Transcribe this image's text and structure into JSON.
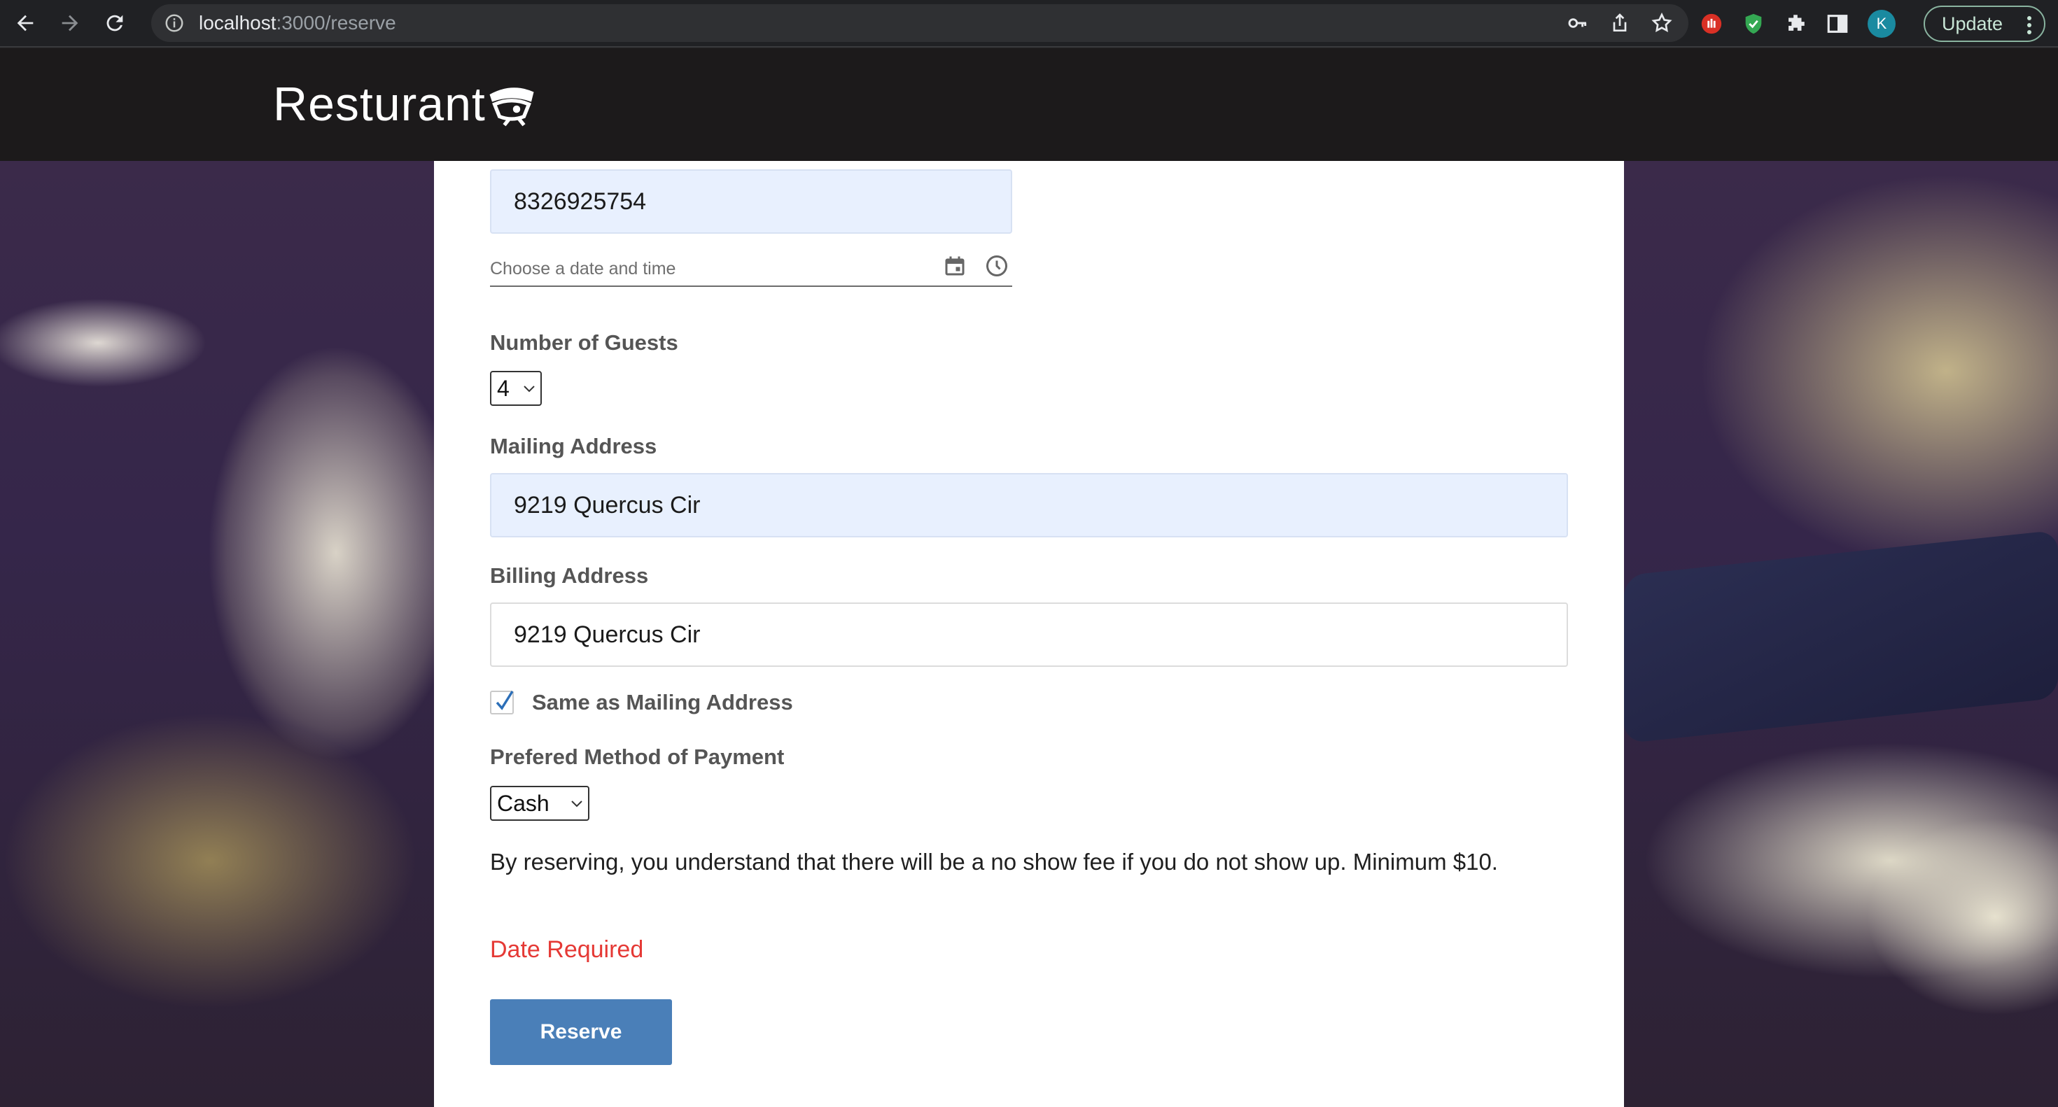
{
  "browser": {
    "url_host": "localhost",
    "url_path": ":3000/reserve",
    "avatar_letter": "K",
    "update_label": "Update",
    "icons": [
      "back-arrow-icon",
      "forward-arrow-icon",
      "reload-icon",
      "info-icon",
      "key-icon",
      "share-icon",
      "star-icon",
      "extension-icon",
      "sidepanel-icon"
    ]
  },
  "site": {
    "brand": "Resturant"
  },
  "form": {
    "phone_value": "8326925754",
    "date_placeholder": "Choose a date and time",
    "guests_label": "Number of Guests",
    "guests_value": "4",
    "mailing_label": "Mailing Address",
    "mailing_value": "9219 Quercus Cir",
    "billing_label": "Billing Address",
    "billing_value": "9219 Quercus Cir",
    "same_as_label": "Same as Mailing Address",
    "same_as_checked": true,
    "payment_label": "Prefered Method of Payment",
    "payment_value": "Cash",
    "notice": "By reserving, you understand that there will be a no show fee if you do not show up. Minimum $10.",
    "error": "Date Required",
    "reserve_label": "Reserve"
  },
  "colors": {
    "accent": "#4a7fb8",
    "error": "#e53935",
    "filled_field": "#e8f0fe",
    "header_bg": "#1c1a1b"
  }
}
